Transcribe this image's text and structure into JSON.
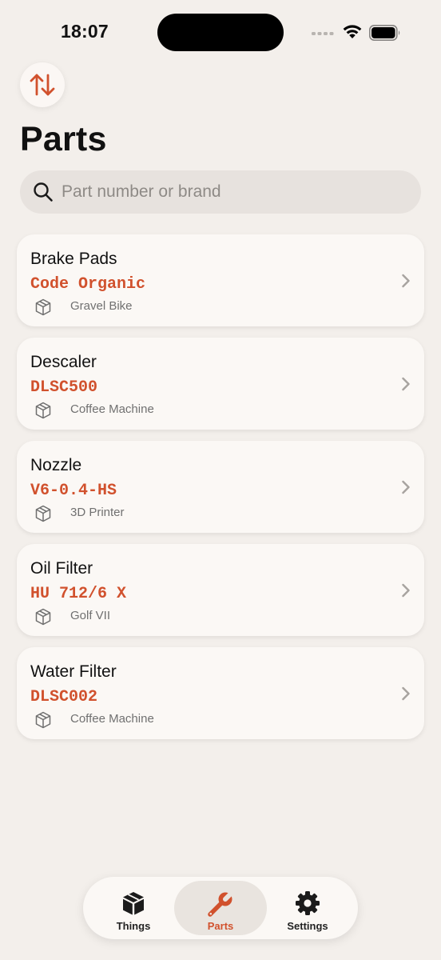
{
  "status_bar": {
    "time": "18:07"
  },
  "header": {
    "sort_icon": "arrow-up-down-icon",
    "title": "Parts"
  },
  "search": {
    "placeholder": "Part number or brand",
    "value": ""
  },
  "parts": [
    {
      "name": "Brake Pads",
      "number": "Code Organic",
      "thing": "Gravel Bike"
    },
    {
      "name": "Descaler",
      "number": "DLSC500",
      "thing": "Coffee Machine"
    },
    {
      "name": "Nozzle",
      "number": "V6-0.4-HS",
      "thing": "3D Printer"
    },
    {
      "name": "Oil Filter",
      "number": "HU 712/6 X",
      "thing": "Golf VII"
    },
    {
      "name": "Water Filter",
      "number": "DLSC002",
      "thing": "Coffee Machine"
    }
  ],
  "tab_bar": {
    "tabs": [
      {
        "label": "Things",
        "icon": "box-icon",
        "active": false
      },
      {
        "label": "Parts",
        "icon": "wrench-icon",
        "active": true
      },
      {
        "label": "Settings",
        "icon": "gear-icon",
        "active": false
      }
    ]
  },
  "colors": {
    "accent": "#D1512D",
    "background": "#F3EFEB",
    "card": "#FBF8F5",
    "search_field": "#E7E2DE",
    "secondary_text": "#707070"
  }
}
